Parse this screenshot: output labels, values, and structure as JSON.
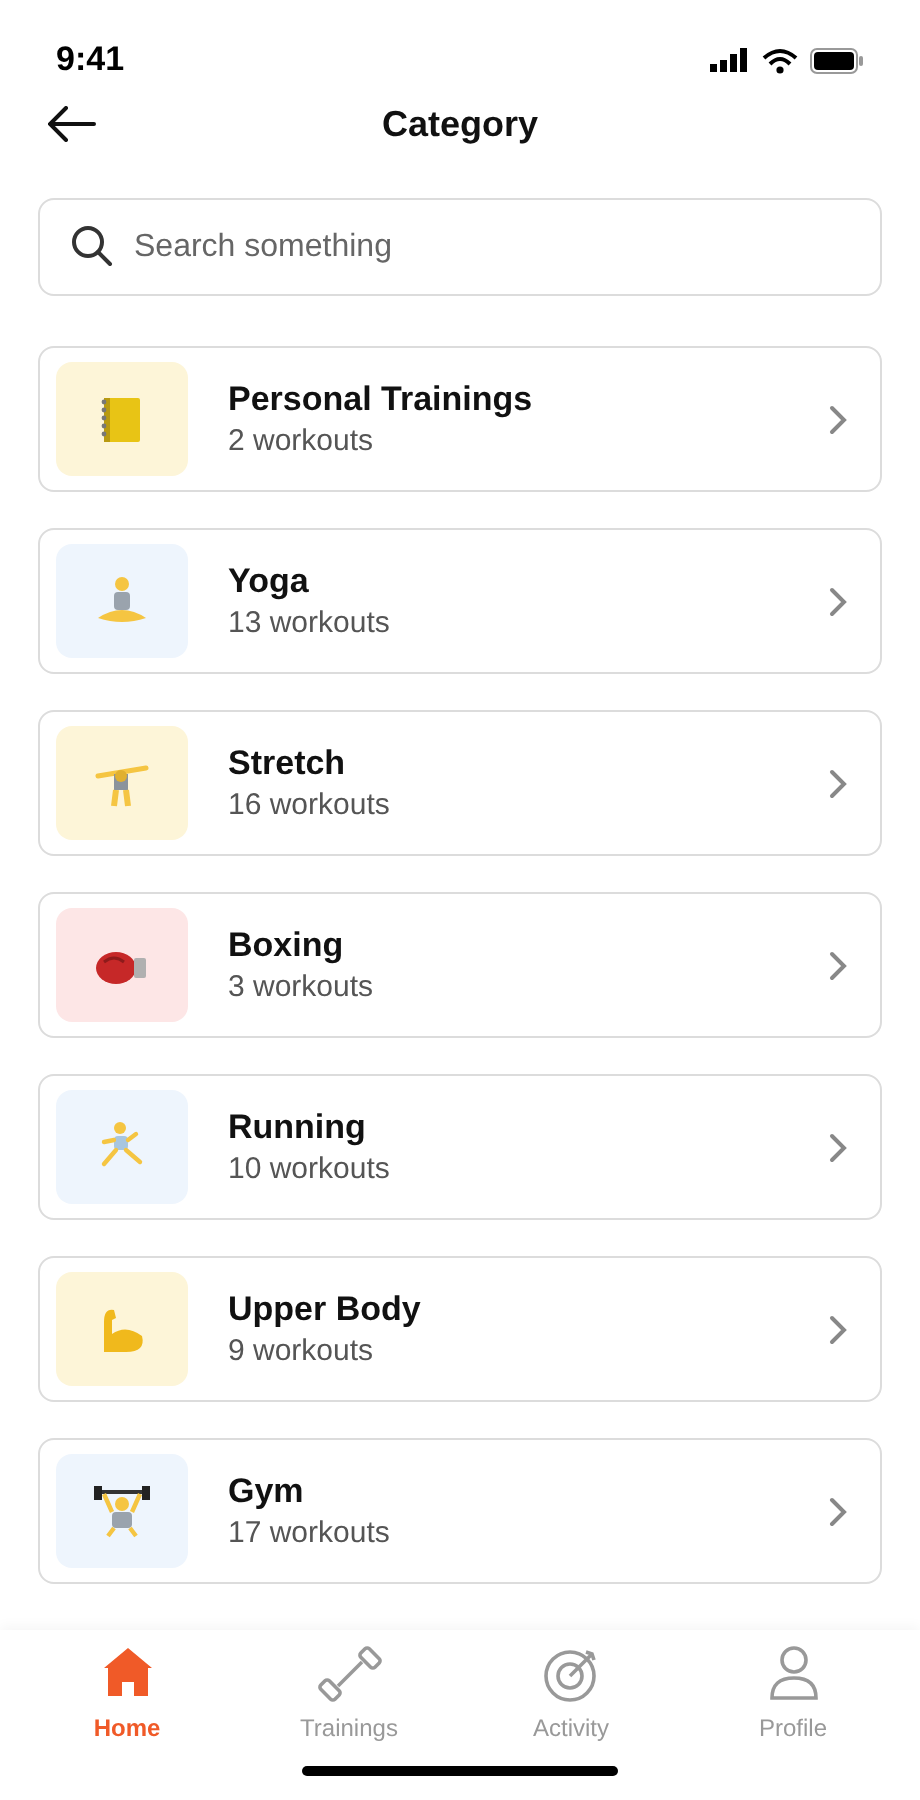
{
  "status_bar": {
    "time": "9:41"
  },
  "header": {
    "title": "Category"
  },
  "search": {
    "placeholder": "Search something"
  },
  "categories": [
    {
      "name": "Personal Trainings",
      "count": "2 workouts",
      "color": "#fdf5d8"
    },
    {
      "name": "Yoga",
      "count": "13 workouts",
      "color": "#eef5fd"
    },
    {
      "name": "Stretch",
      "count": "16 workouts",
      "color": "#fdf5d8"
    },
    {
      "name": "Boxing",
      "count": "3 workouts",
      "color": "#fde6e6"
    },
    {
      "name": "Running",
      "count": "10 workouts",
      "color": "#eef5fd"
    },
    {
      "name": "Upper Body",
      "count": "9 workouts",
      "color": "#fdf5d8"
    },
    {
      "name": "Gym",
      "count": "17 workouts",
      "color": "#eef5fd"
    }
  ],
  "tab_bar": [
    {
      "label": "Home",
      "selected": true
    },
    {
      "label": "Trainings",
      "selected": false
    },
    {
      "label": "Activity",
      "selected": false
    },
    {
      "label": "Profile",
      "selected": false
    }
  ]
}
